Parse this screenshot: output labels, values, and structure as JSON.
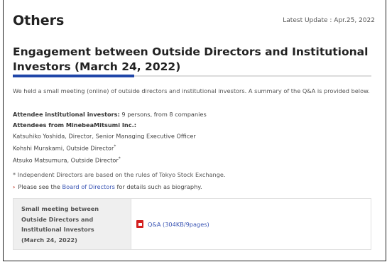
{
  "page": {
    "title": "Others",
    "latest_update": "Latest Update : Apr.25, 2022"
  },
  "section": {
    "heading": "Engagement between Outside Directors and Institutional Investors (March 24, 2022)",
    "intro": "We held a small meeting (online) of outside directors and institutional investors. A summary of the Q&A is provided below.",
    "investors_label": "Attendee institutional investors:",
    "investors_value": " 9 persons, from 8 companies",
    "attendees_label": "Attendees from MinebeaMitsumi Inc.:",
    "attendees": [
      {
        "name": "Katsuhiko Yoshida, Director, Senior Managing Executive Officer",
        "mark": ""
      },
      {
        "name": "Kohshi Murakami, Outside Director",
        "mark": "*"
      },
      {
        "name": "Atsuko Matsumura, Outside Director",
        "mark": "*"
      }
    ],
    "note": "* Independent Directors are based on the rules of Tokyo Stock Exchange.",
    "see_prefix": "Please see the ",
    "see_link": "Board of Directors",
    "see_suffix": " for details such as biography."
  },
  "table": {
    "header_lines": [
      "Small meeting between",
      "Outside Directors and",
      "Institutional Investors",
      "(March 24, 2022)"
    ],
    "file_link": "Q&A (304KB/9pages)",
    "file_icon": "pdf-icon",
    "icon_color": "#d32020"
  },
  "colors": {
    "accent": "#1f46a8",
    "link": "#3a55b4"
  }
}
